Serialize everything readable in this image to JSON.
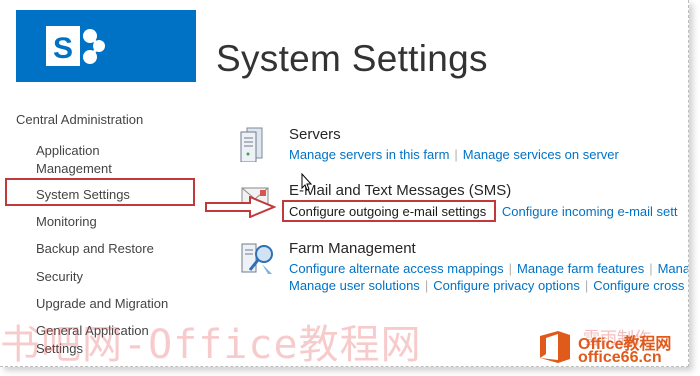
{
  "header": {
    "title": "System Settings"
  },
  "nav": {
    "root": "Central Administration",
    "items": [
      {
        "label": "Application Management"
      },
      {
        "label": "System Settings"
      },
      {
        "label": "Monitoring"
      },
      {
        "label": "Backup and Restore"
      },
      {
        "label": "Security"
      },
      {
        "label": "Upgrade and Migration"
      },
      {
        "label": "General Application Settings"
      }
    ]
  },
  "sections": {
    "servers": {
      "title": "Servers",
      "links": [
        "Manage servers in this farm",
        "Manage services on server"
      ]
    },
    "email": {
      "title": "E-Mail and Text Messages (SMS)",
      "links": [
        "Configure outgoing e-mail settings",
        "Configure incoming e-mail sett"
      ]
    },
    "farm": {
      "title": "Farm Management",
      "links_row1": [
        "Configure alternate access mappings",
        "Manage farm features",
        "Mana"
      ],
      "links_row2": [
        "Manage user solutions",
        "Configure privacy options",
        "Configure cross"
      ]
    }
  },
  "watermark": {
    "text": "书吧网-Office教程网",
    "small": "雪雨制作",
    "brand": "Office教程网",
    "url": "office66.cn"
  },
  "colors": {
    "brand_blue": "#0072c6",
    "link": "#0072c6",
    "highlight_red": "#c0393b",
    "office_orange": "#e05a1c"
  },
  "icons": {
    "logo": "sharepoint-logo-icon",
    "servers": "server-icon",
    "email": "envelope-icon",
    "farm": "farm-management-icon",
    "arrow": "right-arrow-icon",
    "cursor": "mouse-cursor-icon"
  }
}
